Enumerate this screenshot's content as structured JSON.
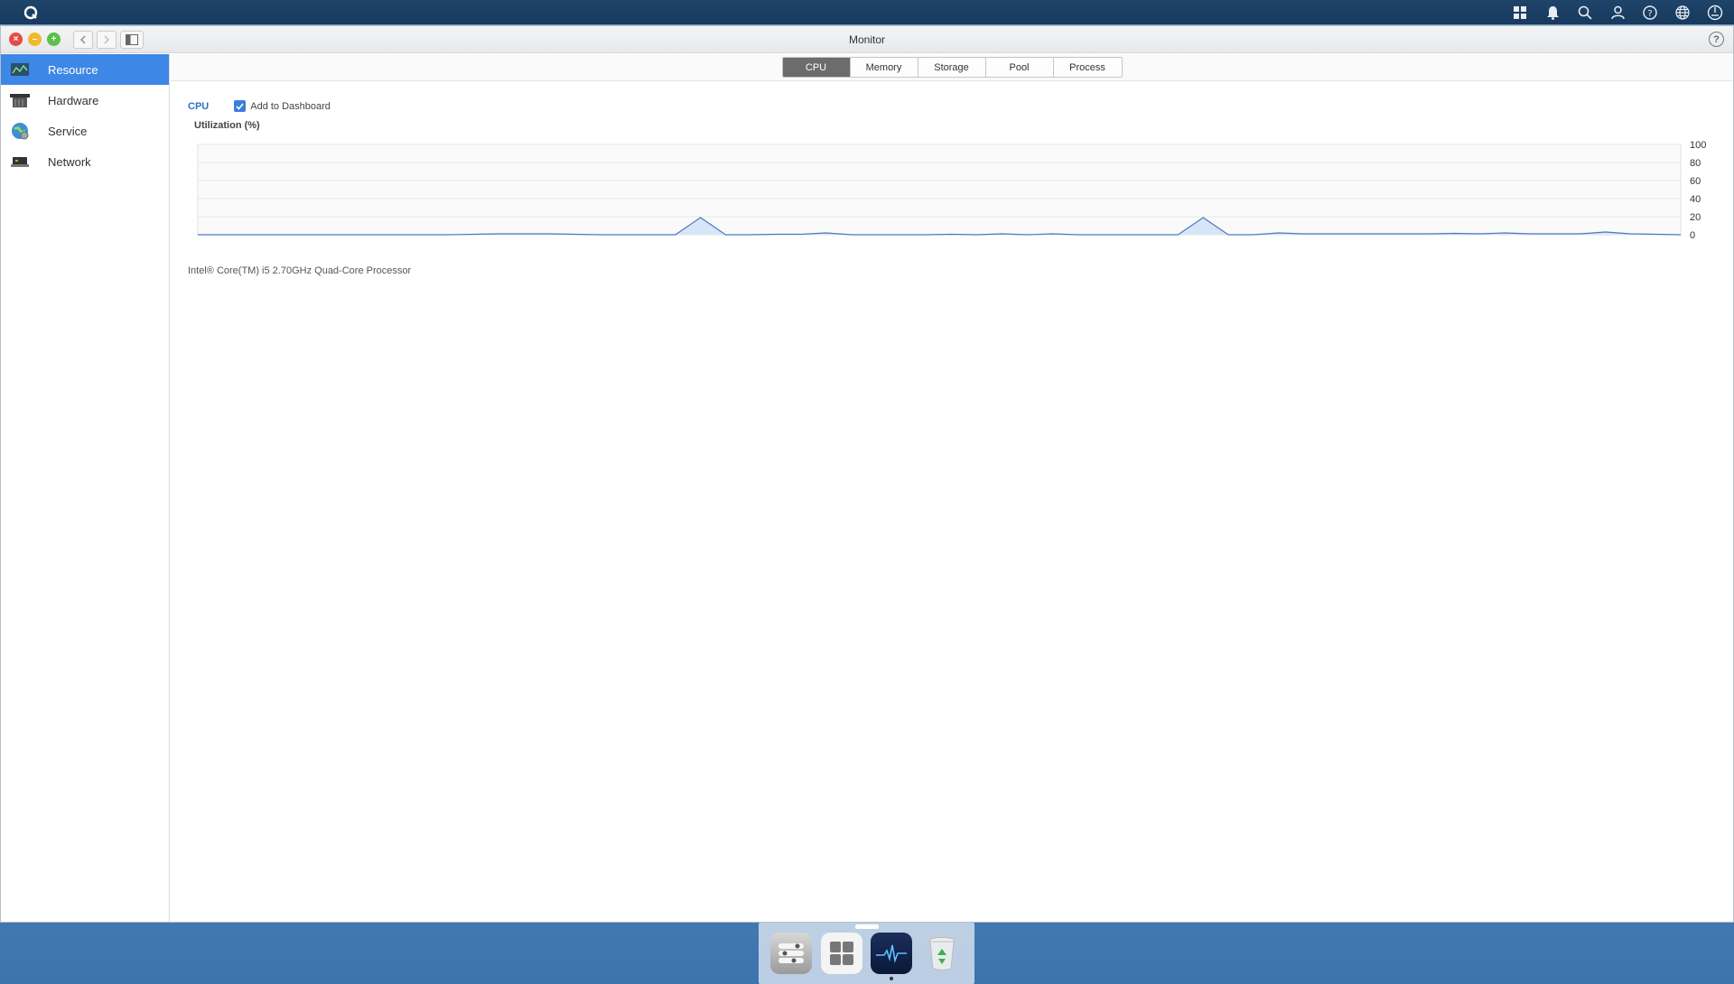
{
  "window": {
    "title": "Monitor",
    "help": "?"
  },
  "sidebar": {
    "items": [
      {
        "label": "Resource",
        "icon": "resource-chart-icon",
        "active": true
      },
      {
        "label": "Hardware",
        "icon": "hardware-icon",
        "active": false
      },
      {
        "label": "Service",
        "icon": "globe-service-icon",
        "active": false
      },
      {
        "label": "Network",
        "icon": "network-device-icon",
        "active": false
      }
    ]
  },
  "tabs": [
    {
      "label": "CPU",
      "active": true
    },
    {
      "label": "Memory",
      "active": false
    },
    {
      "label": "Storage",
      "active": false
    },
    {
      "label": "Pool",
      "active": false
    },
    {
      "label": "Process",
      "active": false
    }
  ],
  "section": {
    "title": "CPU",
    "add_to_dashboard_label": "Add to Dashboard",
    "add_to_dashboard_checked": true,
    "utilization_label": "Utilization (%)",
    "processor": "Intel® Core(TM) i5 2.70GHz Quad-Core Processor"
  },
  "chart_data": {
    "type": "area",
    "ylabel": "Utilization (%)",
    "ylim": [
      0,
      100
    ],
    "yticks": [
      100,
      80,
      60,
      40,
      20,
      0
    ],
    "grid": true,
    "x": [
      0,
      1,
      2,
      3,
      4,
      5,
      6,
      7,
      8,
      9,
      10,
      11,
      12,
      13,
      14,
      15,
      16,
      17,
      18,
      19,
      20,
      21,
      22,
      23,
      24,
      25,
      26,
      27,
      28,
      29,
      30,
      31,
      32,
      33,
      34,
      35,
      36,
      37,
      38,
      39,
      40,
      41,
      42,
      43,
      44,
      45,
      46,
      47,
      48,
      49,
      50,
      51,
      52,
      53,
      54,
      55,
      56,
      57,
      58,
      59
    ],
    "values": [
      0,
      0,
      0,
      0,
      0,
      0,
      0,
      0,
      0,
      0,
      0,
      0.5,
      1,
      1,
      1,
      0.5,
      0,
      0,
      0,
      0,
      19,
      0,
      0,
      0.5,
      0.5,
      2,
      0,
      0,
      0,
      0,
      0.5,
      0,
      1,
      0,
      1,
      0,
      0,
      0,
      0,
      0,
      19,
      0,
      0,
      2,
      1,
      1,
      1,
      1,
      1,
      1,
      1.5,
      1,
      2,
      1,
      1,
      1,
      3,
      1,
      0.5,
      0
    ],
    "color": "#4a79c4",
    "fill": "#d7e5f7"
  },
  "dock": {
    "apps": [
      {
        "name": "control-panel-icon"
      },
      {
        "name": "app-grid-icon"
      },
      {
        "name": "monitor-app-icon",
        "running": true
      },
      {
        "name": "recycle-bin-icon"
      }
    ]
  },
  "colors": {
    "topbar": "#1c4066",
    "accent": "#3d87e6",
    "tab_active": "#6c6c6c"
  }
}
